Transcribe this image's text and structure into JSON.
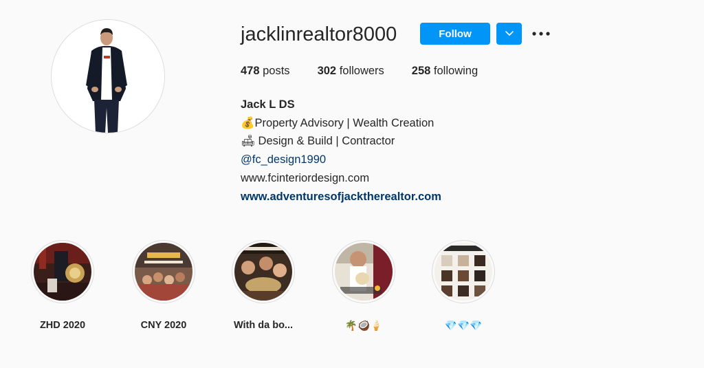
{
  "profile": {
    "username": "jacklinrealtor8000",
    "follow_label": "Follow",
    "stats": {
      "posts_count": "478",
      "posts_label": "posts",
      "followers_count": "302",
      "followers_label": "followers",
      "following_count": "258",
      "following_label": "following"
    },
    "bio": {
      "name": "Jack L DS",
      "line1": "💰Property Advisory | Wealth Creation",
      "line2": "🛋 Design & Build | Contractor",
      "mention": "@fc_design1990",
      "website_text": "www.fcinteriordesign.com",
      "link": "www.adventuresofjacktherealtor.com"
    }
  },
  "highlights": [
    {
      "label": "ZHD 2020"
    },
    {
      "label": "CNY 2020"
    },
    {
      "label": "With da bo..."
    },
    {
      "label": "🌴🥥🍦"
    },
    {
      "label": "💎💎💎"
    }
  ],
  "colors": {
    "accent": "#0095f6",
    "link": "#00376b",
    "background": "#fafafa",
    "text": "#262626"
  },
  "icons": [
    "chevron-down-icon",
    "more-options-icon"
  ]
}
